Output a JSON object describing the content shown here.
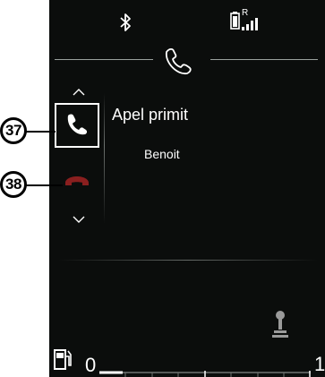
{
  "call": {
    "status_text": "Apel primit",
    "caller_name": "Benoit"
  },
  "callouts": {
    "accept": "37",
    "reject": "38"
  },
  "status_bar": {
    "carrier_indicator": "R"
  },
  "gauge": {
    "left_value": "0",
    "right_value": "1"
  },
  "icons": {
    "bluetooth": "bluetooth-icon",
    "battery": "battery-icon",
    "signal": "signal-icon",
    "phone": "phone-icon",
    "accept_call": "accept-call-icon",
    "reject_call": "reject-call-icon",
    "scroll_up": "chevron-up-icon",
    "scroll_down": "chevron-down-icon",
    "gear": "gear-lever-icon",
    "fuel": "fuel-pump-icon"
  },
  "colors": {
    "background": "#0b0d0c",
    "accept_border": "#ffffff",
    "reject": "#8a1f1f"
  }
}
